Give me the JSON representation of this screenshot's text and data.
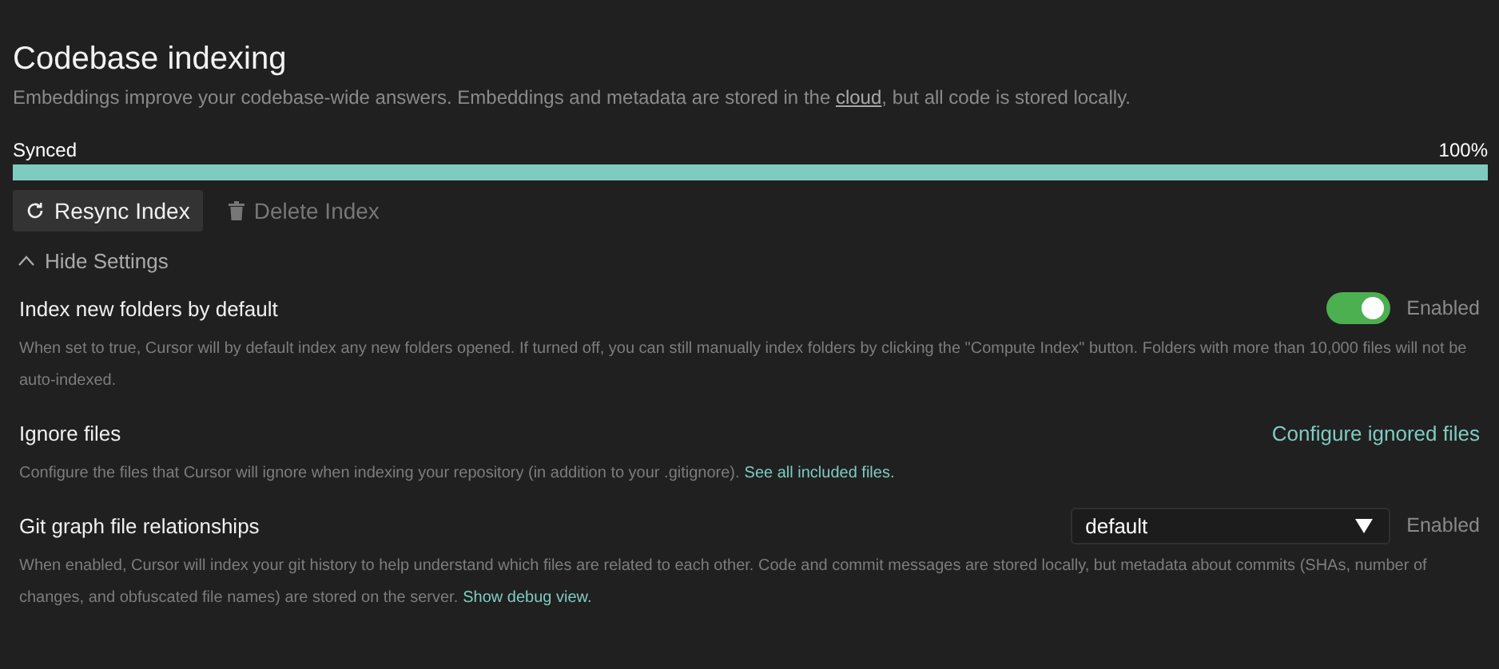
{
  "title": "Codebase indexing",
  "subtitle": {
    "before": "Embeddings improve your codebase-wide answers. Embeddings and metadata are stored in the ",
    "link": "cloud",
    "after": ", but all code is stored locally."
  },
  "progress": {
    "label": "Synced",
    "percent": "100%",
    "level": 1
  },
  "buttons": [
    {
      "label": "Resync Index",
      "kind": "resync",
      "disabled": false
    },
    {
      "label": "Delete Index",
      "kind": "delete",
      "disabled": true
    }
  ],
  "settings_toggle": {
    "label": "Hide Settings",
    "expanded": true
  },
  "settings": [
    {
      "kind": "toggle",
      "label": "Index new folders by default",
      "on": true,
      "status": "Enabled",
      "description": "When set to true, Cursor will by default index any new folders opened. If turned off, you can still manually index folders by clicking the \"Compute Index\" button. Folders with more than 10,000 files will not be auto-indexed."
    },
    {
      "kind": "link",
      "label": "Ignore files",
      "action": "Configure ignored files",
      "description": "Configure the files that Cursor will ignore when indexing your repository (in addition to your .gitignore).",
      "description_link": "See all included files."
    },
    {
      "kind": "select",
      "label": "Git graph file relationships",
      "value": "default",
      "status": "Enabled",
      "description": "When enabled, Cursor will index your git history to help understand which files are related to each other. Code and commit messages are stored locally, but metadata about commits (SHAs, number of changes, and obfuscated file names) are stored on the server.",
      "description_link": "Show debug view."
    }
  ]
}
